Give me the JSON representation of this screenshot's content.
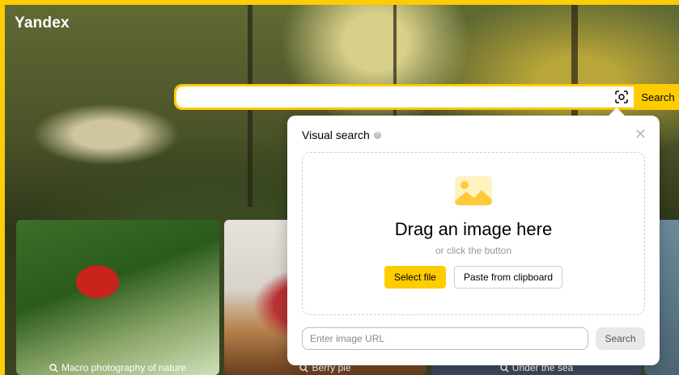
{
  "brand": {
    "logo": "Yandex",
    "accent": "#ffcc00"
  },
  "search": {
    "value": "",
    "button_label": "Search",
    "camera_icon": "camera-lens-icon"
  },
  "cards": [
    {
      "label": "Macro photography of nature",
      "icon": "search-icon"
    },
    {
      "label": "Berry pie",
      "icon": "search-icon"
    },
    {
      "label": "Under the sea",
      "icon": "search-icon"
    }
  ],
  "visual_search": {
    "title": "Visual search",
    "help_icon": "help-icon",
    "close_icon": "close-icon",
    "image_icon": "image-placeholder-icon",
    "drag_title": "Drag an image here",
    "drag_subtitle": "or click the button",
    "select_file_label": "Select file",
    "paste_label": "Paste from clipboard",
    "url_placeholder": "Enter image URL",
    "url_search_label": "Search"
  }
}
